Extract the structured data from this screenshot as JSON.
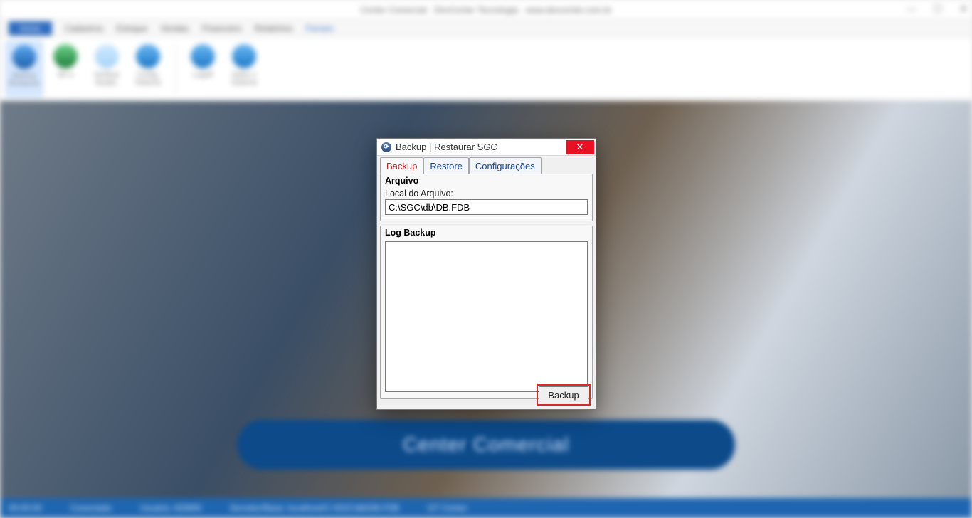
{
  "window": {
    "title": "Center Comercial · DevCenter Tecnologia · www.devcenter.com.br"
  },
  "menubar": {
    "items": [
      "Início",
      "Cadastros",
      "Estoque",
      "Vendas",
      "Financeiro",
      "Relatórios",
      "Ferram."
    ]
  },
  "ribbon": {
    "items": [
      {
        "label": "Backup Restaurar",
        "selected": true,
        "color": "#2f6cc0"
      },
      {
        "label": "NF-e",
        "selected": false,
        "color": "#2f9f4e"
      },
      {
        "label": "Verificar Atualiz.",
        "selected": false,
        "color": "#bfe2ff"
      },
      {
        "label": "Config. Sistema",
        "selected": false,
        "color": "#1c88d6"
      },
      {
        "label": "Logoff",
        "selected": false,
        "color": "#1c88d6"
      },
      {
        "label": "Sobre o Sistema",
        "selected": false,
        "color": "#1c88d6"
      }
    ]
  },
  "brand": {
    "logo_text": "Center Comercial"
  },
  "statusbar": {
    "items": [
      "00:00:00",
      "Conectado",
      "Usuário: ADMIN",
      "Servidor/Base: localhost/C:\\SGC\\db\\DB.FDB",
      "GT Center"
    ]
  },
  "dialog": {
    "title": "Backup | Restaurar SGC",
    "tabs": {
      "backup": "Backup",
      "restore": "Restore",
      "config": "Configurações"
    },
    "arquivo_legend": "Arquivo",
    "local_label": "Local do Arquivo:",
    "path_value": "C:\\SGC\\db\\DB.FDB",
    "log_legend": "Log Backup",
    "log_value": "",
    "backup_button": "Backup"
  }
}
